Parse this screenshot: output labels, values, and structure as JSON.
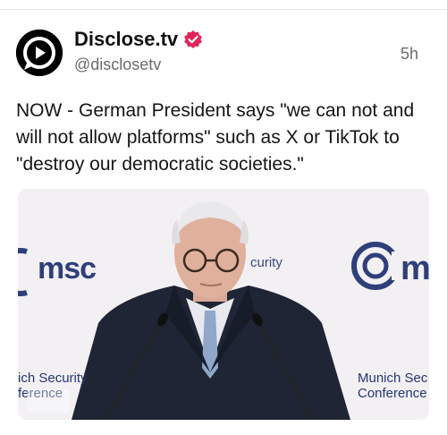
{
  "post": {
    "author_name": "Disclose.tv",
    "author_handle": "@disclosetv",
    "time_ago": "5h",
    "text": "NOW - German President says \"we can not and will not allow platforms\" such as X or TikTok to \"destroy our democratic societies.\""
  },
  "icons": {
    "avatar": "play-logo-icon",
    "verified": "verified-badge-icon"
  },
  "media": {
    "logo_left": "msc",
    "logo_mid": "curity",
    "logo_right": "m",
    "caption_left": [
      "ich Security",
      "ference"
    ],
    "caption_right": [
      "Munich Sec",
      "Conference"
    ]
  },
  "colors": {
    "brand_blue": "#2e3f7a",
    "verified_pink": "#e0245e"
  }
}
